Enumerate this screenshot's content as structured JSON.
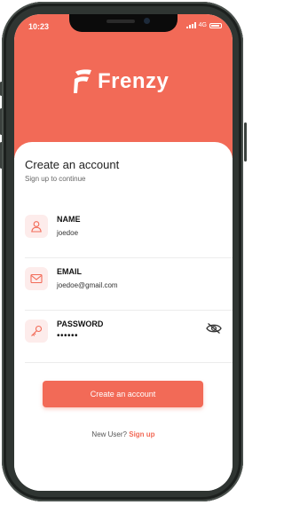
{
  "theme": {
    "accent": "#f26a57",
    "icon_bg": "#fdeceb",
    "frame": "#2f3532"
  },
  "status_bar": {
    "time": "10:23",
    "network": "4G",
    "icons": [
      "signal-icon",
      "battery-icon"
    ]
  },
  "brand": {
    "name": "Frenzy",
    "icon": "frenzy-logo-icon"
  },
  "form": {
    "title": "Create an account",
    "subtitle": "Sign up to continue",
    "fields": [
      {
        "label": "NAME",
        "value": "joedoe",
        "icon": "user-icon"
      },
      {
        "label": "EMAIL",
        "value": "joedoe@gmail.com",
        "icon": "mail-icon"
      },
      {
        "label": "PASSWORD",
        "value": "••••••",
        "icon": "key-icon",
        "toggle_icon": "eye-off-icon"
      }
    ],
    "submit_label": "Create an account"
  },
  "footer": {
    "prompt": "New User?",
    "link": "Sign up"
  }
}
